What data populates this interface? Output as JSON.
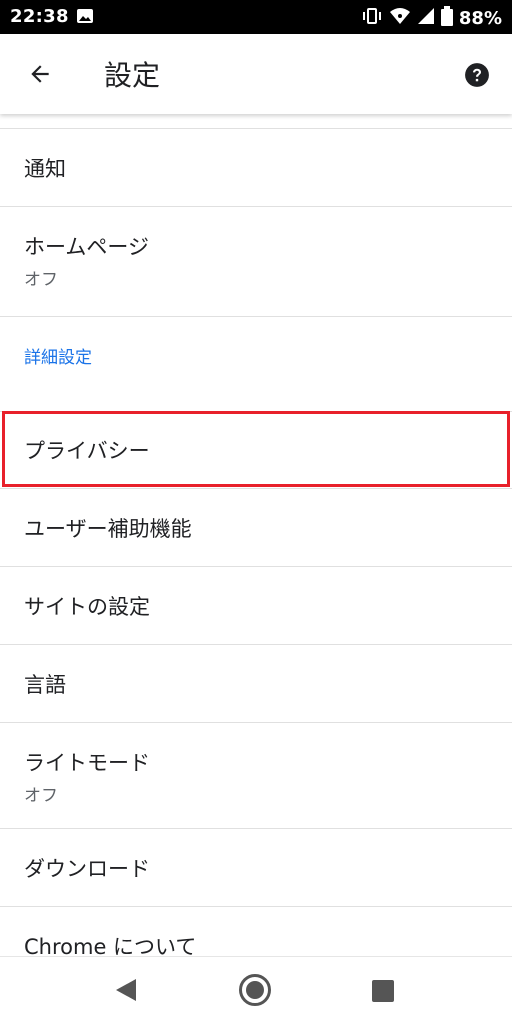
{
  "status_bar": {
    "time": "22:38",
    "battery": "88%",
    "icons": [
      "photo-icon",
      "vibrate-icon",
      "wifi-icon",
      "signal-icon",
      "battery-icon"
    ]
  },
  "app_bar": {
    "title": "設定",
    "back_icon": "arrow-left-icon",
    "help_icon": "help-circle-icon"
  },
  "settings": {
    "items": [
      {
        "label": "通知"
      },
      {
        "label": "ホームページ",
        "sub": "オフ"
      },
      {
        "section": "詳細設定"
      },
      {
        "label": "プライバシー",
        "highlighted": true
      },
      {
        "label": "ユーザー補助機能"
      },
      {
        "label": "サイトの設定"
      },
      {
        "label": "言語"
      },
      {
        "label": "ライトモード",
        "sub": "オフ"
      },
      {
        "label": "ダウンロード"
      },
      {
        "label": "Chrome について"
      }
    ]
  },
  "colors": {
    "accent": "#1a73e8",
    "highlight_border": "#e8202a",
    "status_bar_bg": "#000000"
  },
  "nav_bar": {
    "icons": [
      "back-triangle-icon",
      "home-circle-icon",
      "recent-square-icon"
    ]
  }
}
